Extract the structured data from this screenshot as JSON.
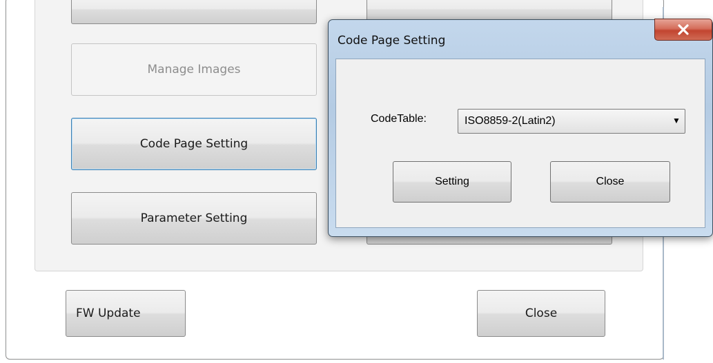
{
  "main_window": {
    "buttons": {
      "manage_images": "Manage Images",
      "code_page_setting": "Code Page Setting",
      "parameter_setting": "Parameter Setting",
      "fw_update": "FW Update",
      "close": "Close"
    }
  },
  "dialog": {
    "title": "Code Page Setting",
    "code_table_label": "CodeTable:",
    "code_table_value": "ISO8859-2(Latin2)",
    "setting_label": "Setting",
    "close_label": "Close",
    "close_icon": "close-x-icon",
    "dropdown_icon": "dropdown-arrow-icon"
  },
  "colors": {
    "focus_border": "#3c7fb1",
    "dialog_frame": "#b4cbe3",
    "close_button": "#c24530"
  }
}
